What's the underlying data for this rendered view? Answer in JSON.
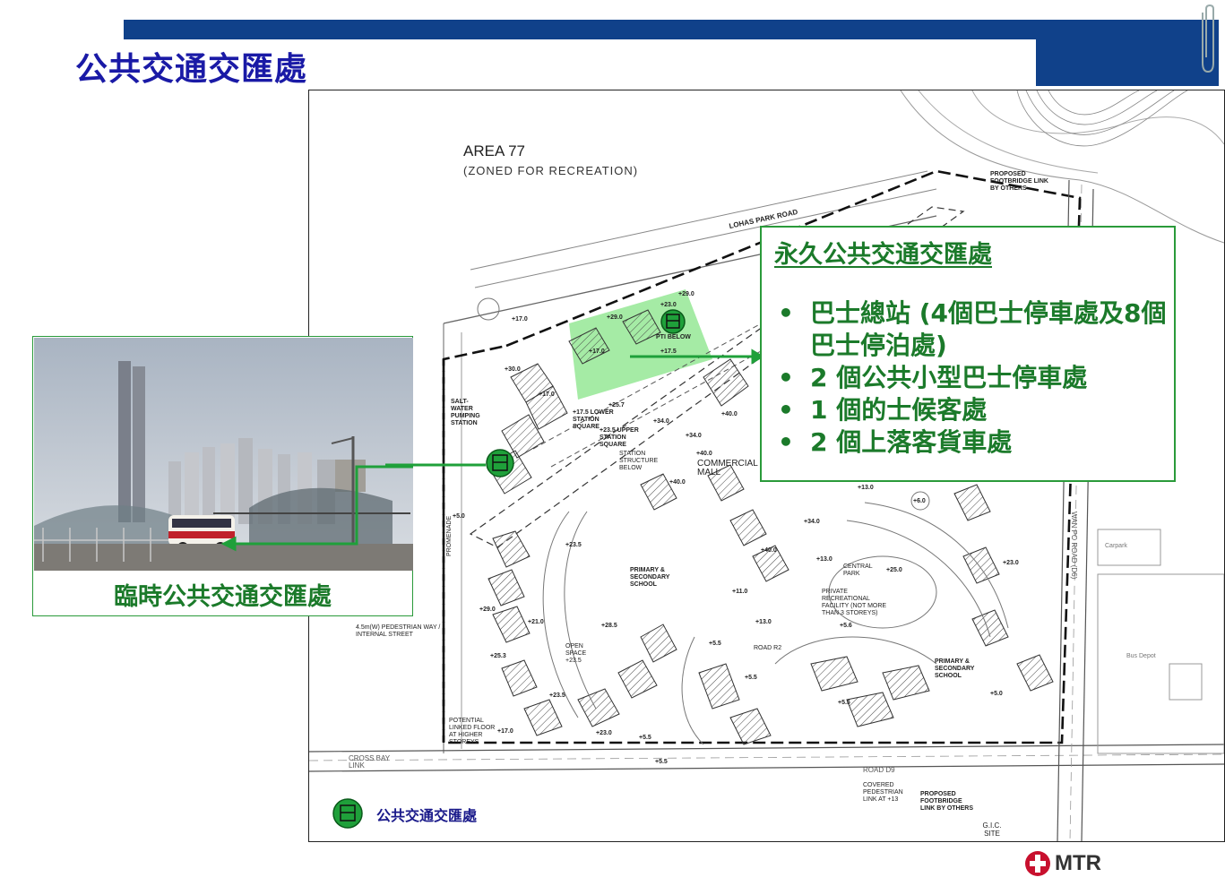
{
  "slide": {
    "title": "公共交通交匯處",
    "brand_color": "#10418a",
    "accent_green": "#1b7a2a"
  },
  "plan": {
    "area_title": "AREA 77",
    "area_subtitle": "(ZONED FOR RECREATION)",
    "labels": {
      "lohas_park_road": "LOHAS PARK ROAD",
      "proposed_footbridge_top": "PROPOSED FOOTBRIDGE LINK BY OTHERS",
      "pti_below": "PTI BELOW",
      "salt_water": "SALT-WATER PUMPING STATION",
      "lower_station_square": "+17.5 LOWER STATION SQUARE",
      "upper_station_square": "+23.5 UPPER STATION SQUARE",
      "station_structure": "STATION STRUCTURE BELOW",
      "commercial_mall": "COMMERCIAL MALL",
      "primary_secondary_1": "PRIMARY & SECONDARY SCHOOL",
      "primary_secondary_2": "PRIMARY & SECONDARY SCHOOL",
      "central_park": "CENTRAL PARK",
      "private_rec": "PRIVATE RECREATIONAL FACILITY (NOT MORE THAN 3 STOREYS)",
      "open_space": "OPEN SPACE +23.5",
      "promenade": "PROMENADE",
      "pedestrian_way": "4.5m(W) PEDESTRIAN WAY / INTERNAL STREET",
      "potential_linked": "POTENTIAL LINKED FLOOR AT HIGHER STOREYS",
      "cross_bay_link": "CROSS BAY LINK",
      "road_d9": "ROAD D9",
      "covered_link": "COVERED PEDESTRIAN LINK AT +13",
      "proposed_footbridge_bottom": "PROPOSED FOOTBRIDGE LINK BY OTHERS",
      "gic_site": "G.I.C. SITE",
      "wan_po_road": "WAN PO ROAD (D6)",
      "road_r2": "ROAD R2",
      "carpark": "Carpark",
      "bus_depot": "Bus Depot"
    },
    "levels": [
      "+29.0",
      "+23.0",
      "+29.0",
      "+17.0",
      "+17.5",
      "+17.0",
      "+30.0",
      "+17.0",
      "+25.7",
      "+34.0",
      "+40.0",
      "+34.0",
      "+40.0",
      "+40.0",
      "+34.0",
      "+40.0",
      "+23.5",
      "+13.0",
      "+25.0",
      "+23.0",
      "+11.0",
      "+13.0",
      "+28.5",
      "+21.0",
      "+25.3",
      "+29.0",
      "+23.5",
      "+5.5",
      "+5.5",
      "+5.5",
      "+23.0",
      "+5.0",
      "+5.0",
      "+6.0",
      "+17.0",
      "+5.5",
      "+5.5",
      "+13.0",
      "+5.6"
    ]
  },
  "permanent_pti": {
    "title": "永久公共交通交匯處",
    "items": [
      "巴士總站 (4個巴士停車處及8個巴士停泊處)",
      "2 個公共小型巴士停車處",
      "1 個的士候客處",
      "2 個上落客貨車處"
    ]
  },
  "temporary_pti": {
    "caption": "臨時公共交通交匯處"
  },
  "legend": {
    "icon": "bus-icon",
    "label": "公共交通交匯處"
  },
  "logo": {
    "text": "MTR"
  }
}
